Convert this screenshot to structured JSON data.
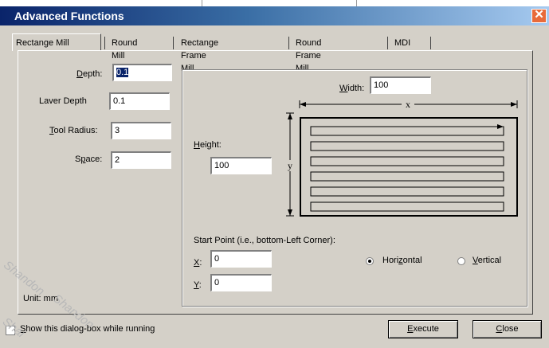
{
  "window": {
    "title": "Advanced Functions",
    "close_glyph": "✕"
  },
  "tabs": [
    {
      "label": "Rectange Mill"
    },
    {
      "label": "Round Mill"
    },
    {
      "label": "Rectange Frame Mill"
    },
    {
      "label": "Round Frame Mill"
    },
    {
      "label": "MDI"
    }
  ],
  "params": {
    "depth": {
      "label_pre": "",
      "label_u": "D",
      "label_post": "epth:",
      "value": "0.1"
    },
    "layer_depth": {
      "label": "Laver Depth",
      "value": "0.1"
    },
    "tool_radius": {
      "label_pre": "",
      "label_u": "T",
      "label_post": "ool Radius:",
      "value": "3"
    },
    "space": {
      "label_pre": "S",
      "label_u": "p",
      "label_post": "ace:",
      "value": "2"
    }
  },
  "geometry": {
    "width": {
      "label_u": "W",
      "label_post": "idth:",
      "value": "100"
    },
    "height": {
      "label_u": "H",
      "label_post": "eight:",
      "value": "100"
    },
    "diagram": {
      "x_label": "x",
      "y_label": "y"
    }
  },
  "start_point": {
    "label": "Start Point (i.e., bottom-Left Corner):",
    "x": {
      "label_u": "X",
      "label_post": ":",
      "value": "0"
    },
    "y": {
      "label_u": "Y",
      "label_post": ":",
      "value": "0"
    }
  },
  "direction": {
    "horizontal": {
      "label_pre": "Hori",
      "label_u": "z",
      "label_post": "ontal",
      "selected": true
    },
    "vertical": {
      "label_u": "V",
      "label_post": "ertical",
      "selected": false
    }
  },
  "unit_label": "Unit: mm",
  "footer": {
    "show_dialog": {
      "label_u": "S",
      "label_post": "how this dialog-box while running",
      "checked": false
    },
    "execute": {
      "label_u": "E",
      "label_post": "xecute"
    },
    "close": {
      "label_u": "C",
      "label_post": "lose"
    }
  },
  "watermark": {
    "line1": "Shandon",
    "line2": "Shandon",
    "line3": "Shai"
  }
}
